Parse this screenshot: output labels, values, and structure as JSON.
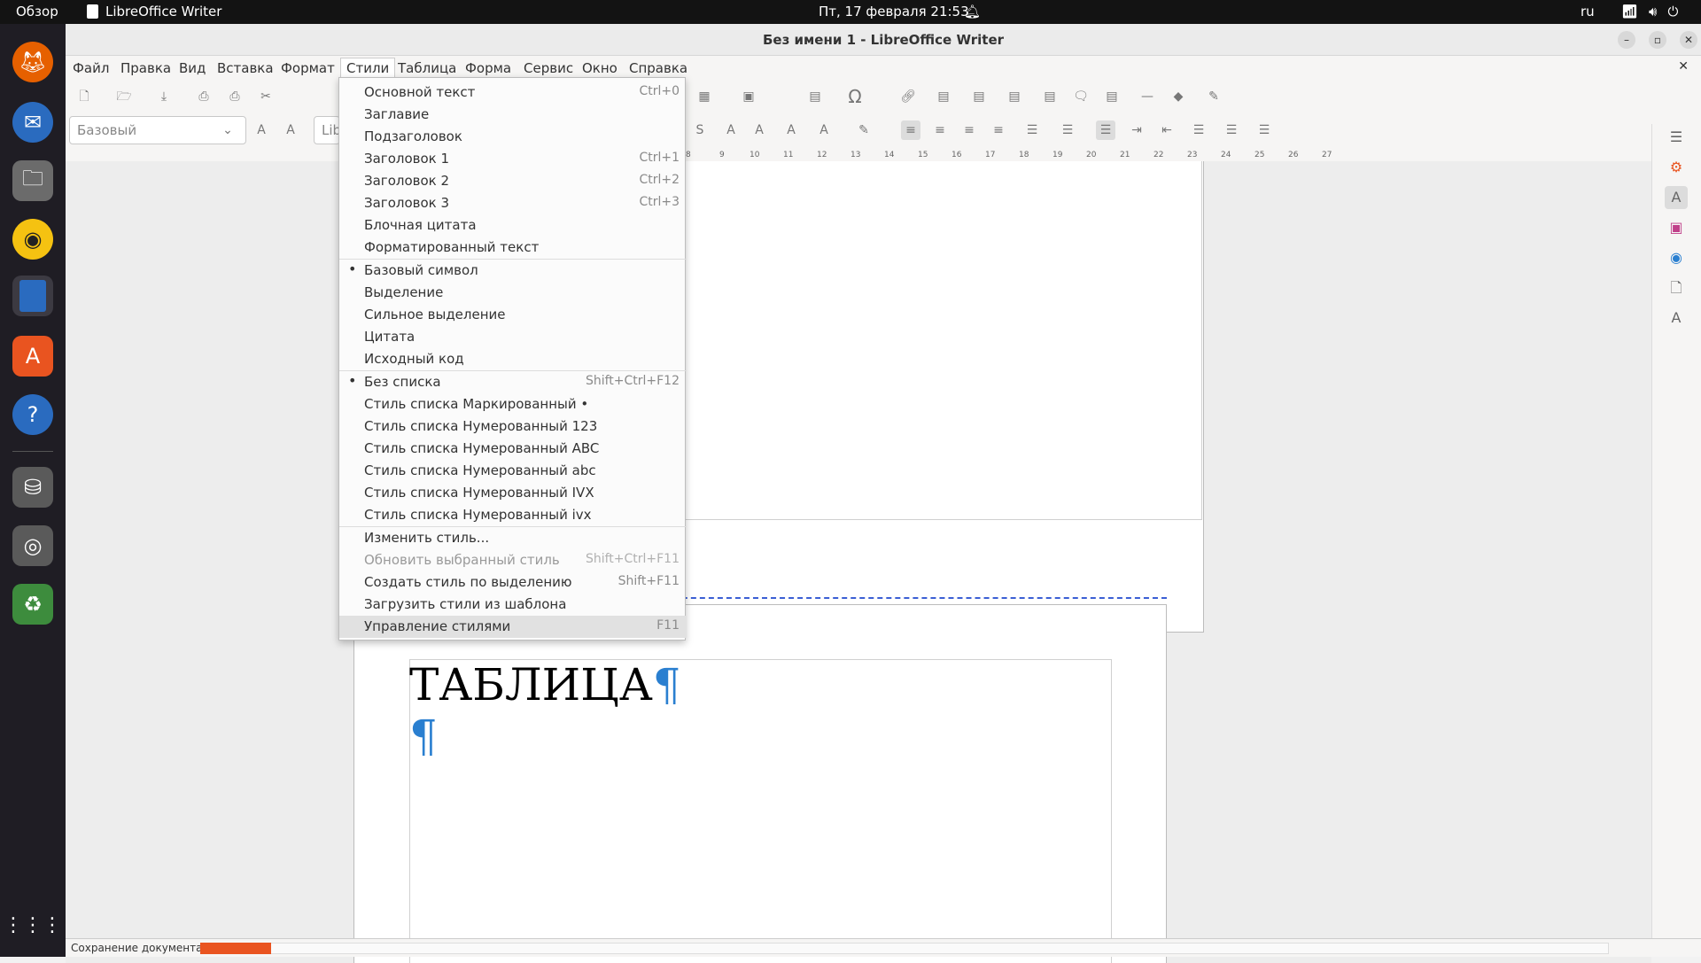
{
  "topbar": {
    "overview": "Обзор",
    "app_name": "LibreOffice Writer",
    "datetime": "Пт, 17 февраля  21:53",
    "lang": "ru"
  },
  "window": {
    "title": "Без имени 1 - LibreOffice Writer"
  },
  "menubar": {
    "items": [
      "Файл",
      "Правка",
      "Вид",
      "Вставка",
      "Формат",
      "Стили",
      "Таблица",
      "Форма",
      "Сервис",
      "Окно",
      "Справка"
    ],
    "open_item": "Стили"
  },
  "toolbar": {
    "para_style": "Базовый",
    "font_name": "Lib"
  },
  "ruler": {
    "ticks": [
      "8",
      "9",
      "10",
      "11",
      "12",
      "13",
      "14",
      "15",
      "16",
      "17",
      "18",
      "19",
      "20",
      "21",
      "22",
      "23",
      "24",
      "25",
      "26",
      "27"
    ]
  },
  "document": {
    "heading": "ТАБЛИЦА",
    "pilcrow": "¶"
  },
  "styles_menu": {
    "groups": [
      [
        {
          "label": "Основной текст",
          "shortcut": "Ctrl+0"
        },
        {
          "label": "Заглавие",
          "shortcut": ""
        },
        {
          "label": "Подзаголовок",
          "shortcut": ""
        },
        {
          "label": "Заголовок 1",
          "shortcut": "Ctrl+1"
        },
        {
          "label": "Заголовок 2",
          "shortcut": "Ctrl+2"
        },
        {
          "label": "Заголовок 3",
          "shortcut": "Ctrl+3"
        },
        {
          "label": "Блочная цитата",
          "shortcut": ""
        },
        {
          "label": "Форматированный текст",
          "shortcut": ""
        }
      ],
      [
        {
          "label": "Базовый символ",
          "shortcut": "",
          "bullet": true
        },
        {
          "label": "Выделение",
          "shortcut": ""
        },
        {
          "label": "Сильное выделение",
          "shortcut": ""
        },
        {
          "label": "Цитата",
          "shortcut": ""
        },
        {
          "label": "Исходный код",
          "shortcut": ""
        }
      ],
      [
        {
          "label": "Без списка",
          "shortcut": "Shift+Ctrl+F12",
          "bullet": true
        },
        {
          "label": "Стиль списка Маркированный •",
          "shortcut": ""
        },
        {
          "label": "Стиль списка Нумерованный 123",
          "shortcut": ""
        },
        {
          "label": "Стиль списка Нумерованный ABC",
          "shortcut": ""
        },
        {
          "label": "Стиль списка Нумерованный abc",
          "shortcut": ""
        },
        {
          "label": "Стиль списка Нумерованный IVX",
          "shortcut": ""
        },
        {
          "label": "Стиль списка Нумерованный ivx",
          "shortcut": ""
        }
      ],
      [
        {
          "label": "Изменить стиль...",
          "shortcut": ""
        },
        {
          "label": "Обновить выбранный стиль",
          "shortcut": "Shift+Ctrl+F11",
          "disabled": true
        },
        {
          "label": "Создать стиль по выделению",
          "shortcut": "Shift+F11"
        },
        {
          "label": "Загрузить стили из шаблона",
          "shortcut": ""
        },
        {
          "label": "Управление стилями",
          "shortcut": "F11",
          "highlighted": true
        }
      ]
    ]
  },
  "statusbar": {
    "text": "Сохранение документа...",
    "progress": 0.05
  },
  "colors": {
    "accent": "#e95420",
    "pilcrow": "#2a7fd0",
    "pagebreak": "#3b5fd4"
  }
}
